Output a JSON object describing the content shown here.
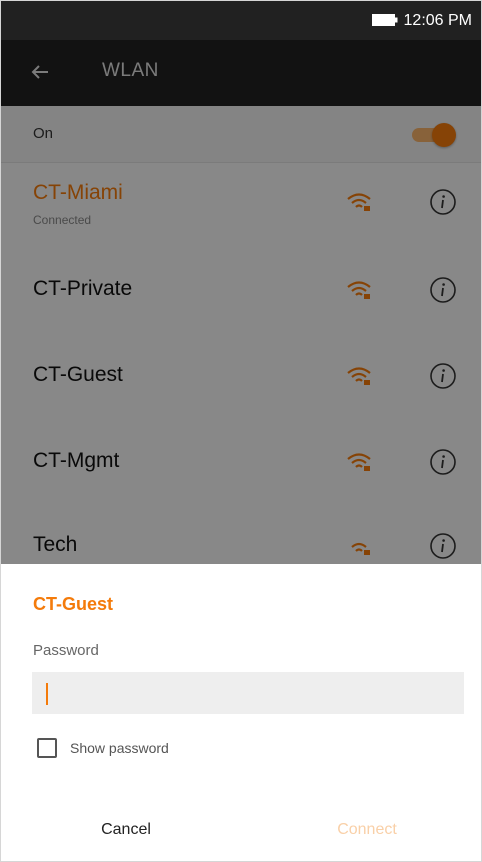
{
  "status_bar": {
    "time": "12:06 PM",
    "battery_icon": "battery-icon"
  },
  "app_bar": {
    "title": "WLAN",
    "back_icon": "arrow-left-icon"
  },
  "wlan_toggle": {
    "label": "On",
    "enabled": true
  },
  "networks": [
    {
      "name": "CT-Miami",
      "status": "Connected",
      "connected": true
    },
    {
      "name": "CT-Private",
      "status": "",
      "connected": false
    },
    {
      "name": "CT-Guest",
      "status": "",
      "connected": false
    },
    {
      "name": "CT-Mgmt",
      "status": "",
      "connected": false
    },
    {
      "name": "Tech",
      "status": "",
      "connected": false
    }
  ],
  "dialog": {
    "title": "CT-Guest",
    "password_label": "Password",
    "password_value": "",
    "show_password_label": "Show password",
    "show_password_checked": false,
    "cancel_label": "Cancel",
    "connect_label": "Connect"
  },
  "colors": {
    "accent": "#f47b0b",
    "dark_bar": "#212121"
  }
}
